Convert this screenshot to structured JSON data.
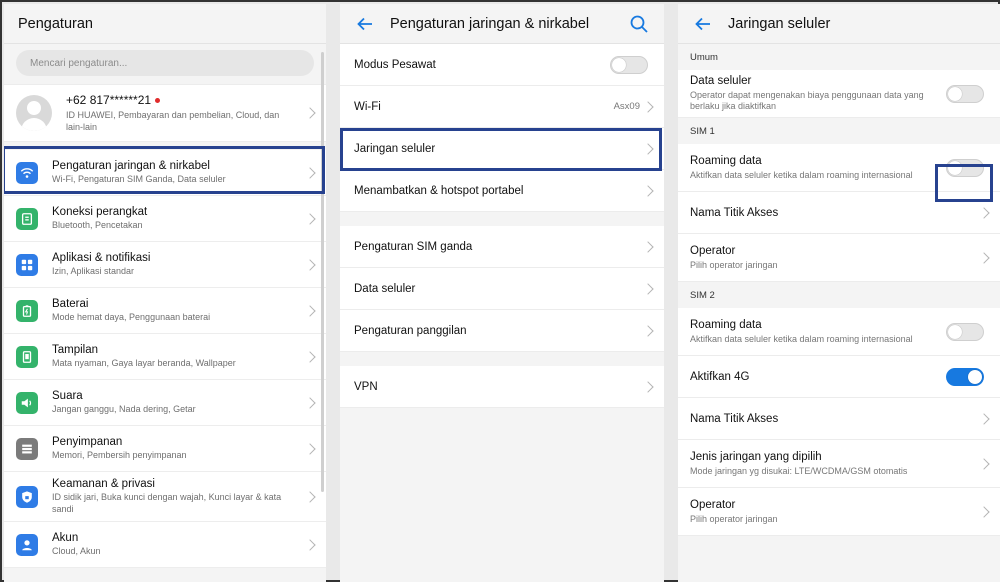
{
  "panel1": {
    "title": "Pengaturan",
    "search_placeholder": "Mencari pengaturan...",
    "account": {
      "number": "+62 817******21",
      "subtitle": "ID HUAWEI, Pembayaran dan pembelian, Cloud, dan lain-lain"
    },
    "items": [
      {
        "title": "Pengaturan jaringan & nirkabel",
        "sub": "Wi-Fi, Pengaturan SIM Ganda, Data seluler",
        "icon": "wifi-icon",
        "color": "#2f7ce6"
      },
      {
        "title": "Koneksi perangkat",
        "sub": "Bluetooth, Pencetakan",
        "icon": "device-connection-icon",
        "color": "#34b36b"
      },
      {
        "title": "Aplikasi & notifikasi",
        "sub": "Izin, Aplikasi standar",
        "icon": "apps-icon",
        "color": "#2f7ce6"
      },
      {
        "title": "Baterai",
        "sub": "Mode hemat daya, Penggunaan baterai",
        "icon": "battery-icon",
        "color": "#34b36b"
      },
      {
        "title": "Tampilan",
        "sub": "Mata nyaman, Gaya layar beranda, Wallpaper",
        "icon": "display-icon",
        "color": "#34b36b"
      },
      {
        "title": "Suara",
        "sub": "Jangan ganggu, Nada dering, Getar",
        "icon": "sound-icon",
        "color": "#34b36b"
      },
      {
        "title": "Penyimpanan",
        "sub": "Memori, Pembersih penyimpanan",
        "icon": "storage-icon",
        "color": "#7b7b7b"
      },
      {
        "title": "Keamanan & privasi",
        "sub": "ID sidik jari, Buka kunci dengan wajah, Kunci layar & kata sandi",
        "icon": "shield-icon",
        "color": "#2f7ce6"
      },
      {
        "title": "Akun",
        "sub": "Cloud, Akun",
        "icon": "account-icon",
        "color": "#2f7ce6"
      }
    ]
  },
  "panel2": {
    "title": "Pengaturan jaringan & nirkabel",
    "group1": [
      {
        "label": "Modus Pesawat",
        "toggle": false
      },
      {
        "label": "Wi-Fi",
        "value": "Asx09"
      },
      {
        "label": "Jaringan seluler"
      },
      {
        "label": "Menambatkan & hotspot portabel"
      }
    ],
    "group2": [
      {
        "label": "Pengaturan SIM ganda"
      },
      {
        "label": "Data seluler"
      },
      {
        "label": "Pengaturan panggilan"
      }
    ],
    "group3": [
      {
        "label": "VPN"
      }
    ]
  },
  "panel3": {
    "title": "Jaringan seluler",
    "section_umum": "Umum",
    "data_seluler": {
      "title": "Data seluler",
      "sub": "Operator dapat mengenakan biaya penggunaan data yang berlaku jika diaktifkan",
      "toggle": false
    },
    "section_sim1": "SIM 1",
    "sim1": {
      "roaming": {
        "title": "Roaming data",
        "sub": "Aktifkan data seluler ketika dalam roaming internasional",
        "toggle": false
      },
      "apn": "Nama Titik Akses",
      "operator": {
        "title": "Operator",
        "sub": "Pilih operator jaringan"
      }
    },
    "section_sim2": "SIM 2",
    "sim2": {
      "roaming": {
        "title": "Roaming data",
        "sub": "Aktifkan data seluler ketika dalam roaming internasional",
        "toggle": false
      },
      "lte": {
        "title": "Aktifkan 4G",
        "toggle": true
      },
      "apn": "Nama Titik Akses",
      "network_type": {
        "title": "Jenis jaringan yang dipilih",
        "sub": "Mode jaringan yg disukai: LTE/WCDMA/GSM otomatis"
      },
      "operator": {
        "title": "Operator",
        "sub": "Pilih operator jaringan"
      }
    }
  },
  "accent": "#1779e0",
  "highlight_color": "#27428f"
}
